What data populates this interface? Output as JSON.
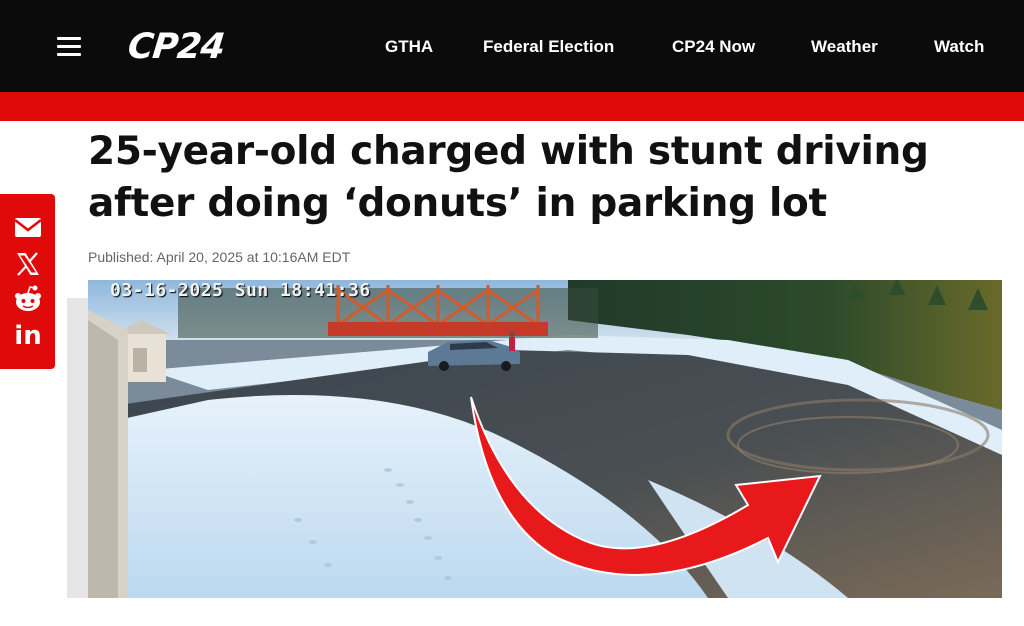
{
  "header": {
    "logo": "CP24",
    "nav": [
      {
        "label": "GTHA"
      },
      {
        "label": "Federal Election"
      },
      {
        "label": "CP24 Now"
      },
      {
        "label": "Weather"
      },
      {
        "label": "Watch"
      }
    ]
  },
  "article": {
    "headline": "25-year-old charged with stunt driving after doing ‘donuts’ in parking lot",
    "published": "Published: April 20, 2025 at 10:16AM EDT"
  },
  "share": {
    "items": [
      {
        "icon": "email-icon"
      },
      {
        "icon": "x-icon"
      },
      {
        "icon": "reddit-icon"
      },
      {
        "icon": "linkedin-icon",
        "label": "in"
      }
    ]
  },
  "photo": {
    "timestamp": "03-16-2025 Sun 18:41:36"
  },
  "colors": {
    "brand_red": "#e10a0a",
    "topbar": "#0b0b0b",
    "arrow": "#e8191b"
  }
}
